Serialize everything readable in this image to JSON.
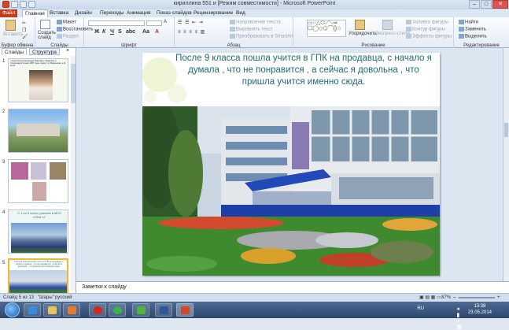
{
  "window": {
    "title": "кириллина 551 и [Режим совместимости] - Microsoft PowerPoint"
  },
  "tabs": [
    {
      "label": "Файл"
    },
    {
      "label": "Главная"
    },
    {
      "label": "Вставка"
    },
    {
      "label": "Дизайн"
    },
    {
      "label": "Переходы"
    },
    {
      "label": "Анимация"
    },
    {
      "label": "Показ слайдов"
    },
    {
      "label": "Рецензирование"
    },
    {
      "label": "Вид"
    }
  ],
  "ribbon": {
    "clipboard": {
      "label": "Буфер обмена",
      "paste": "Вставить"
    },
    "slides": {
      "label": "Слайды",
      "new_slide": "Создать слайд",
      "layout": "Макет",
      "reset": "Восстановить",
      "section": "Раздел"
    },
    "font": {
      "label": "Шрифт"
    },
    "paragraph": {
      "label": "Абзац",
      "text_direction": "Направление текста",
      "align_text": "Выровнять текст",
      "smartart": "Преобразовать в SmartArt"
    },
    "drawing": {
      "label": "Рисование",
      "arrange": "Упорядочить",
      "quick_styles": "Экспресс-стили",
      "shape_fill": "Заливка фигуры",
      "shape_outline": "Контур фигуры",
      "shape_effects": "Эффекты фигуры"
    },
    "editing": {
      "label": "Редактирование",
      "find": "Найти",
      "replace": "Заменить",
      "select": "Выделить"
    }
  },
  "left_pane": {
    "tabs": [
      "Слайды",
      "Структура"
    ],
    "close": "×",
    "thumbnails": [
      {
        "number": "1",
        "text": "• Кириллина Александра Павловна • Родилась в г.Салехард 21 июня 1997 года • Адрес: ул.Ямальская, д.11 кв.16"
      },
      {
        "number": "2",
        "text": ""
      },
      {
        "number": "3",
        "text": ""
      },
      {
        "number": "4",
        "text": "С 1 по 9 класс училась в МОУ СОШ 12"
      },
      {
        "number": "5",
        "text": "После 9 класса пошла учится в ГПК на продавца, с начало я думала , что не понравится , а сейчас я довольна , что пришла учится именно сюда."
      }
    ]
  },
  "slide": {
    "title": "После 9  класса пошла учится в ГПК на продавца, с начало я думала , что не понравится , а сейчас я довольна , что пришла учится именно сюда."
  },
  "notes": {
    "placeholder": "Заметки к слайду"
  },
  "status": {
    "slide_info": "Слайд 5 из 13",
    "theme": "\"Шары\"",
    "language": "русский",
    "zoom": "87%"
  },
  "taskbar": {
    "lang": "RU",
    "time": "13:38",
    "date": "23.05.2014"
  },
  "colors": {
    "accent": "#c33b1f",
    "title_text": "#1e6b6b",
    "ribbon_bg": "#e4ecf6",
    "selected_thumb": "#f3b833"
  }
}
